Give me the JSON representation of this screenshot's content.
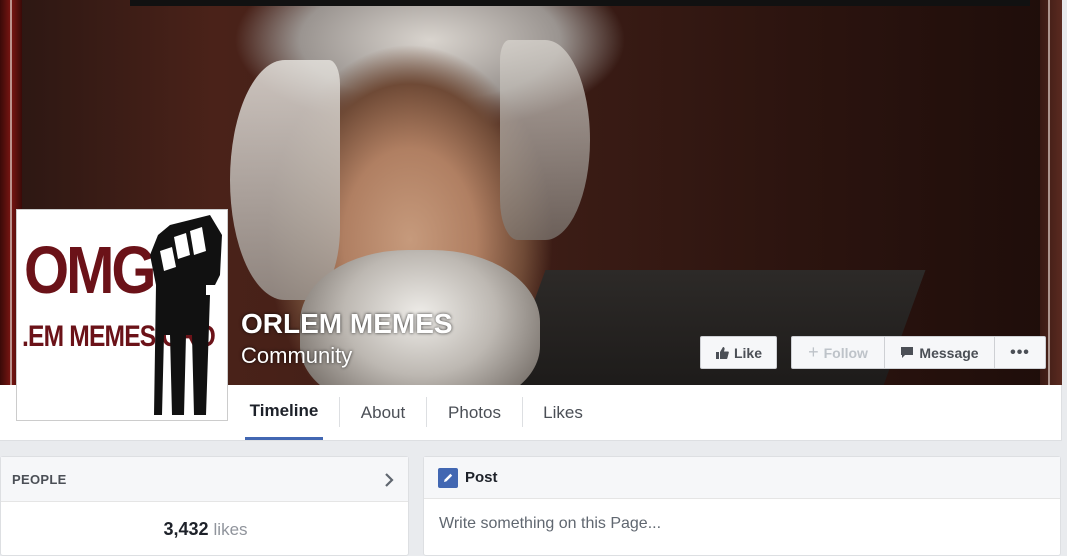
{
  "page": {
    "name": "ORLEM MEMES",
    "category": "Community"
  },
  "profile_picture": {
    "logo_line1": "OMG",
    "logo_line2": ".EM MEMES GRO"
  },
  "actions": {
    "like_label": "Like",
    "follow_label": "Follow",
    "message_label": "Message",
    "more_label": "•••"
  },
  "tabs": [
    {
      "label": "Timeline",
      "active": true
    },
    {
      "label": "About"
    },
    {
      "label": "Photos"
    },
    {
      "label": "Likes"
    }
  ],
  "people": {
    "header": "PEOPLE",
    "likes_count": "3,432",
    "likes_word": "likes"
  },
  "composer": {
    "header": "Post",
    "placeholder": "Write something on this Page..."
  },
  "colors": {
    "accent": "#4267b2",
    "background": "#e9ebee",
    "logo_red": "#6b1218"
  }
}
